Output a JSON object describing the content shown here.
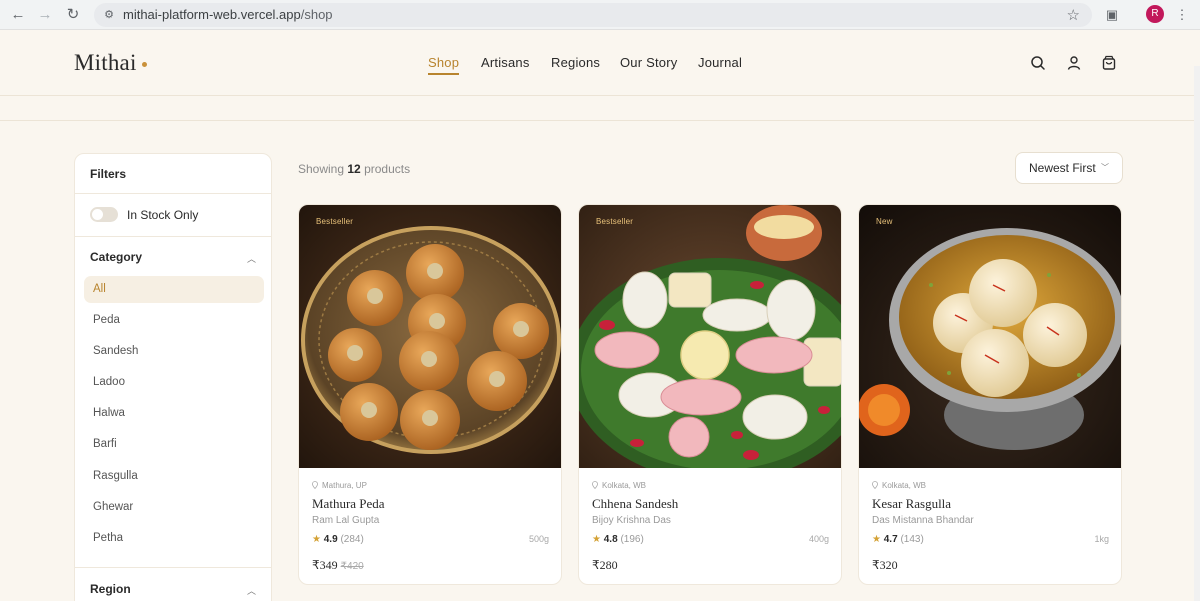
{
  "browser": {
    "url_host": "mithai-platform-web.vercel.app",
    "url_path": "/shop",
    "profile_initial": "R"
  },
  "header": {
    "logo": "Mithai",
    "nav": [
      {
        "label": "Shop",
        "active": true
      },
      {
        "label": "Artisans",
        "active": false
      },
      {
        "label": "Regions",
        "active": false
      },
      {
        "label": "Our Story",
        "active": false
      },
      {
        "label": "Journal",
        "active": false
      }
    ],
    "icons": [
      "search-icon",
      "account-icon",
      "cart-icon"
    ]
  },
  "filters": {
    "title": "Filters",
    "in_stock_label": "In Stock Only",
    "in_stock_on": false,
    "category_title": "Category",
    "categories": [
      "All",
      "Peda",
      "Sandesh",
      "Ladoo",
      "Halwa",
      "Barfi",
      "Rasgulla",
      "Ghewar",
      "Petha"
    ],
    "active_category": "All",
    "region_title": "Region"
  },
  "toolbar": {
    "showing_prefix": "Showing",
    "count": "12",
    "showing_suffix": "products",
    "sort_label": "Newest First"
  },
  "products": [
    {
      "badge": "Bestseller",
      "location": "Mathura, UP",
      "name": "Mathura Peda",
      "maker": "Ram Lal Gupta",
      "rating": "4.9",
      "reviews": "(284)",
      "weight": "500g",
      "price": "₹349",
      "mrp": "₹420"
    },
    {
      "badge": "Bestseller",
      "location": "Kolkata, WB",
      "name": "Chhena Sandesh",
      "maker": "Bijoy Krishna Das",
      "rating": "4.8",
      "reviews": "(196)",
      "weight": "400g",
      "price": "₹280",
      "mrp": ""
    },
    {
      "badge": "New",
      "location": "Kolkata, WB",
      "name": "Kesar Rasgulla",
      "maker": "Das Mistanna Bhandar",
      "rating": "4.7",
      "reviews": "(143)",
      "weight": "1kg",
      "price": "₹320",
      "mrp": ""
    }
  ],
  "colors": {
    "accent": "#b8842e",
    "background": "#faf6ef",
    "brand_dot": "#c9913a"
  }
}
